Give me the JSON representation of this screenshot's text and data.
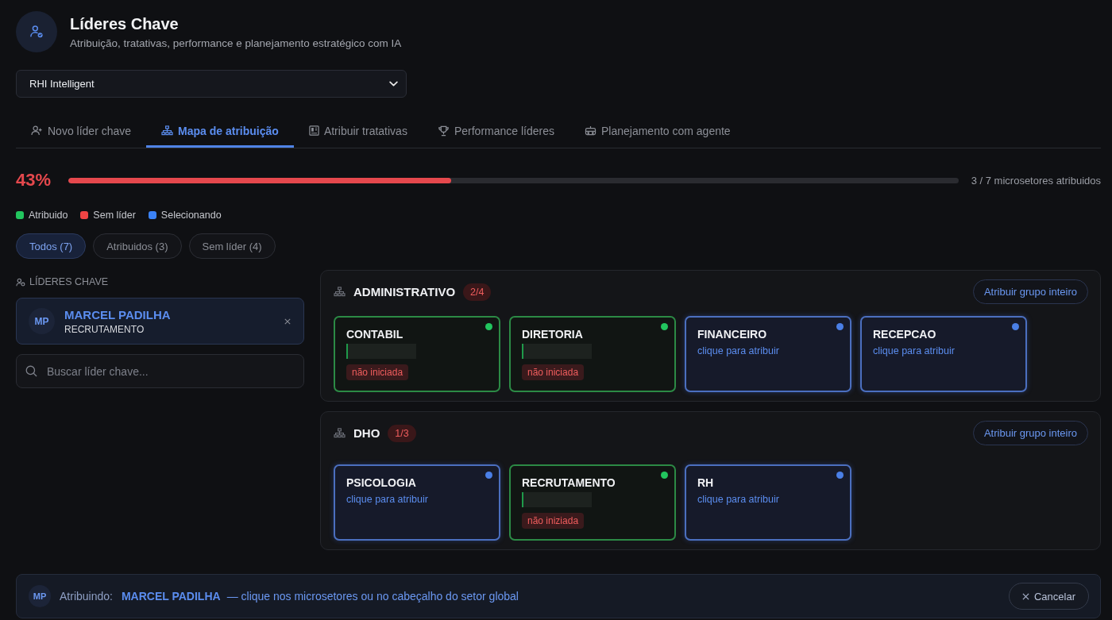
{
  "header": {
    "title": "Líderes Chave",
    "subtitle": "Atribuição, tratativas, performance e planejamento estratégico com IA"
  },
  "company_select": {
    "value": "RHI Intelligent"
  },
  "tabs": [
    {
      "label": "Novo líder chave",
      "selected": false
    },
    {
      "label": "Mapa de atribuição",
      "selected": true
    },
    {
      "label": "Atribuir tratativas",
      "selected": false
    },
    {
      "label": "Performance líderes",
      "selected": false
    },
    {
      "label": "Planejamento com agente",
      "selected": false
    }
  ],
  "progress": {
    "percent": "43%",
    "level": 0.43,
    "summary": "3 / 7 microsetores atribuidos"
  },
  "legend": [
    {
      "label": "Atribuido",
      "color": "#22c55e"
    },
    {
      "label": "Sem líder",
      "color": "#ef4444"
    },
    {
      "label": "Selecionando",
      "color": "#3b82f6"
    }
  ],
  "filters": [
    {
      "label": "Todos (7)",
      "selected": true
    },
    {
      "label": "Atribuidos (3)",
      "selected": false
    },
    {
      "label": "Sem líder (4)",
      "selected": false
    }
  ],
  "leaders_panel": {
    "heading": "LÍDERES CHAVE",
    "leaders": [
      {
        "initials": "MP",
        "name": "MARCEL PADILHA",
        "sector": "RECRUTAMENTO",
        "selected": true
      }
    ],
    "search": {
      "placeholder": "Buscar líder chave..."
    }
  },
  "groups": [
    {
      "name": "ADMINISTRATIVO",
      "count": "2/4",
      "action": "Atribuir grupo inteiro",
      "sectors": [
        {
          "name": "CONTABIL",
          "kind": "assigned",
          "status": "não iniciada"
        },
        {
          "name": "DIRETORIA",
          "kind": "assigned",
          "status": "não iniciada"
        },
        {
          "name": "FINANCEIRO",
          "kind": "selecting",
          "hint": "clique para atribuir"
        },
        {
          "name": "RECEPCAO",
          "kind": "selecting",
          "hint": "clique para atribuir"
        }
      ]
    },
    {
      "name": "DHO",
      "count": "1/3",
      "action": "Atribuir grupo inteiro",
      "sectors": [
        {
          "name": "PSICOLOGIA",
          "kind": "selecting",
          "hint": "clique para atribuir"
        },
        {
          "name": "RECRUTAMENTO",
          "kind": "assigned",
          "status": "não iniziada"
        },
        {
          "name": "RH",
          "kind": "selecting",
          "hint": "clique para atribuir"
        }
      ]
    }
  ],
  "assignment_bar": {
    "initials": "MP",
    "label": "Atribuindo:",
    "name": "MARCEL PADILHA",
    "instruction": "— clique nos microsetores ou no cabeçalho do setor global",
    "cancel": "Cancelar"
  }
}
